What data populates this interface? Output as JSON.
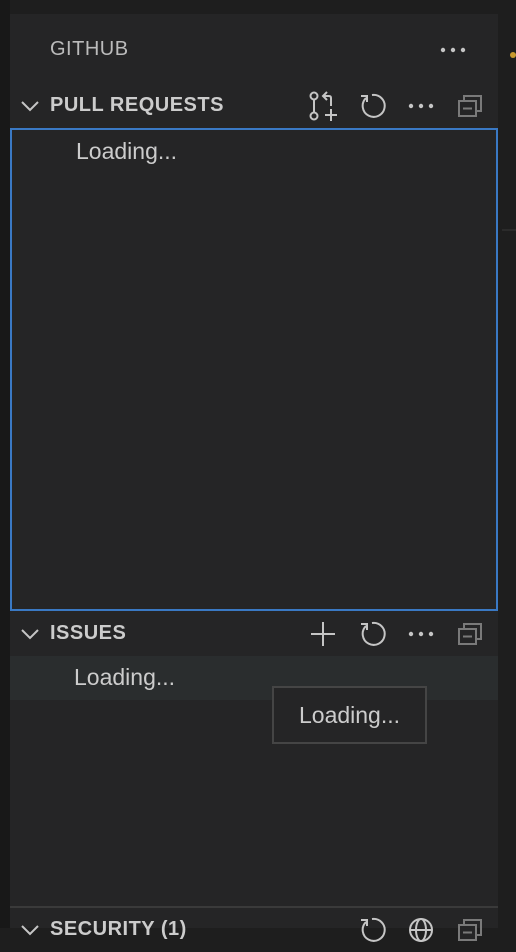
{
  "header": {
    "title": "GITHUB",
    "more_icon": "ellipsis-icon"
  },
  "sections": {
    "pull_requests": {
      "title": "PULL REQUESTS",
      "expanded": true,
      "actions": [
        "create-pull-request-icon",
        "refresh-icon",
        "ellipsis-icon",
        "collapse-all-icon"
      ],
      "items": [
        {
          "label": "Loading..."
        }
      ]
    },
    "issues": {
      "title": "ISSUES",
      "expanded": true,
      "actions": [
        "add-icon",
        "refresh-icon",
        "ellipsis-icon",
        "collapse-all-icon"
      ],
      "items": [
        {
          "label": "Loading..."
        }
      ]
    },
    "security": {
      "title": "SECURITY (1)",
      "actions": [
        "refresh-icon",
        "globe-icon",
        "collapse-all-icon"
      ]
    }
  },
  "tooltip": {
    "text": "Loading..."
  },
  "colors": {
    "sidebar_bg": "#252526",
    "focus_border": "#3a79c4",
    "hover_row": "#2a2d2e"
  }
}
